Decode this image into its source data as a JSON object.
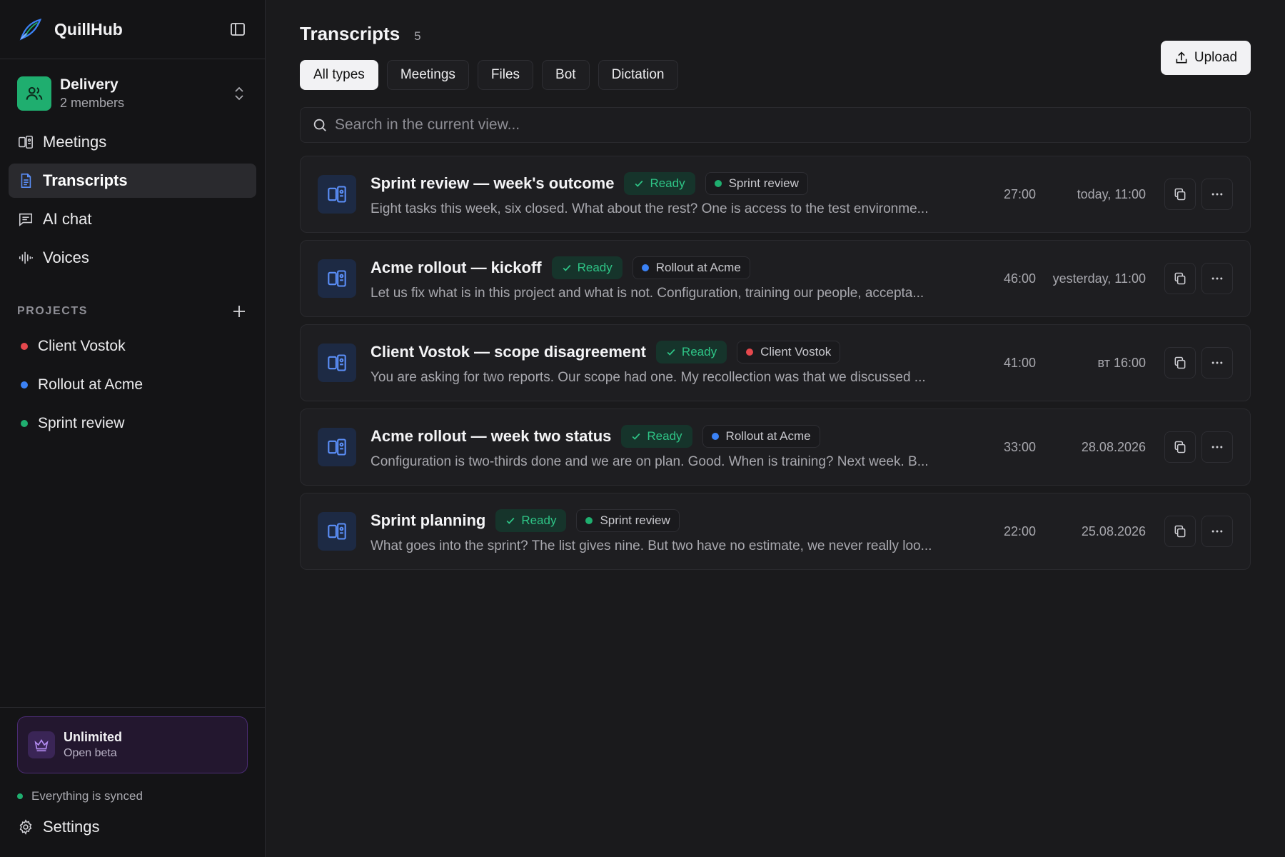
{
  "app": {
    "name": "QuillHub"
  },
  "workspace": {
    "name": "Delivery",
    "members": "2 members"
  },
  "nav": [
    {
      "label": "Meetings",
      "icon": "meeting-icon",
      "active": false
    },
    {
      "label": "Transcripts",
      "icon": "document-icon",
      "active": true
    },
    {
      "label": "AI chat",
      "icon": "chat-icon",
      "active": false
    },
    {
      "label": "Voices",
      "icon": "waveform-icon",
      "active": false
    }
  ],
  "projects": {
    "title": "PROJECTS",
    "items": [
      {
        "label": "Client Vostok",
        "color": "#e5484d"
      },
      {
        "label": "Rollout at Acme",
        "color": "#3b82f6"
      },
      {
        "label": "Sprint review",
        "color": "#1fae6f"
      }
    ]
  },
  "plan": {
    "name": "Unlimited",
    "sub": "Open beta"
  },
  "sync": {
    "status": "Everything is synced"
  },
  "settings": {
    "label": "Settings"
  },
  "main": {
    "title": "Transcripts",
    "count": "5",
    "upload_label": "Upload",
    "filters": [
      {
        "label": "All types",
        "active": true
      },
      {
        "label": "Meetings",
        "active": false
      },
      {
        "label": "Files",
        "active": false
      },
      {
        "label": "Bot",
        "active": false
      },
      {
        "label": "Dictation",
        "active": false
      }
    ],
    "search_placeholder": "Search in the current view...",
    "status_label": "Ready",
    "transcripts": [
      {
        "title": "Sprint review — week's outcome",
        "project": "Sprint review",
        "project_color": "#1fae6f",
        "snippet": "Eight tasks this week, six closed. What about the rest? One is access to the test environme...",
        "duration": "27:00",
        "date": "today, 11:00"
      },
      {
        "title": "Acme rollout — kickoff",
        "project": "Rollout at Acme",
        "project_color": "#3b82f6",
        "snippet": "Let us fix what is in this project and what is not. Configuration, training our people, accepta...",
        "duration": "46:00",
        "date": "yesterday, 11:00"
      },
      {
        "title": "Client Vostok — scope disagreement",
        "project": "Client Vostok",
        "project_color": "#e5484d",
        "snippet": "You are asking for two reports. Our scope had one. My recollection was that we discussed ...",
        "duration": "41:00",
        "date": "вт 16:00"
      },
      {
        "title": "Acme rollout — week two status",
        "project": "Rollout at Acme",
        "project_color": "#3b82f6",
        "snippet": "Configuration is two-thirds done and we are on plan. Good. When is training? Next week. B...",
        "duration": "33:00",
        "date": "28.08.2026"
      },
      {
        "title": "Sprint planning",
        "project": "Sprint review",
        "project_color": "#1fae6f",
        "snippet": "What goes into the sprint? The list gives nine. But two have no estimate, we never really loo...",
        "duration": "22:00",
        "date": "25.08.2026"
      }
    ]
  }
}
